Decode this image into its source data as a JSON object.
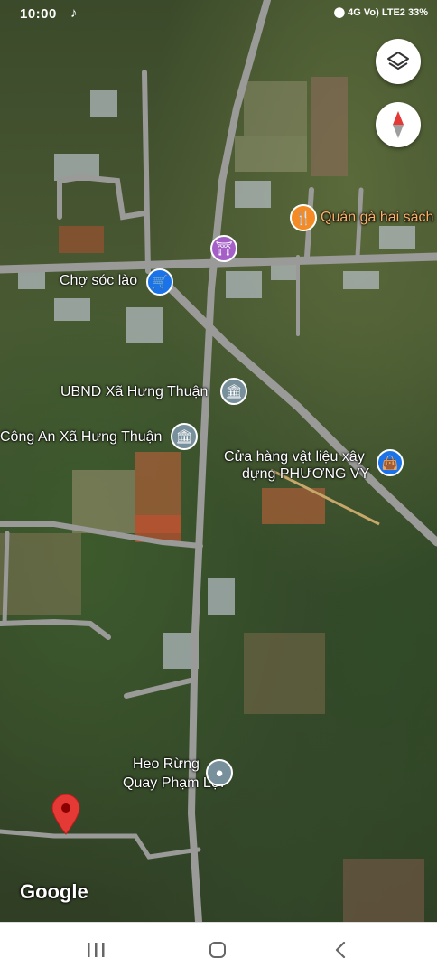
{
  "status_bar": {
    "time": "10:00",
    "right_text": "4G  Vo) LTE2  33%"
  },
  "map": {
    "places": [
      {
        "name": "Quán gà hai sách",
        "icon": "restaurant-icon",
        "color": "#f58b24"
      },
      {
        "name": "Chợ sóc lào",
        "icon": "shopping-cart-icon",
        "color": "#1a73e8"
      },
      {
        "name": "UBND Xã Hưng Thuận",
        "icon": "government-building-icon",
        "color": "#78909c"
      },
      {
        "name": "Công An Xã Hưng Thuận",
        "icon": "government-building-icon",
        "color": "#78909c"
      },
      {
        "name": "Cửa hàng vật liệu xây dựng PHƯƠNG VY",
        "line1": "Cửa hàng vật liệu xây",
        "line2": "dựng PHƯƠNG VY",
        "icon": "shopping-bag-icon",
        "color": "#1a73e8"
      },
      {
        "name": "Heo Rừng Quay Phạm Lợi",
        "line1": "Heo Rừng",
        "line2": "Quay Phạm Lợi",
        "icon": "location-dot-icon",
        "color": "#78909c"
      }
    ],
    "landmark_icon": "temple-icon",
    "landmark_color": "#a560c8",
    "dropped_pin_color": "#e53935",
    "attribution": "Google"
  },
  "controls": {
    "layers_icon": "layers-icon",
    "compass_icon": "compass-icon"
  },
  "nav_bar": {
    "recents_icon": "recent-apps-icon",
    "home_icon": "home-icon",
    "back_icon": "back-icon"
  }
}
